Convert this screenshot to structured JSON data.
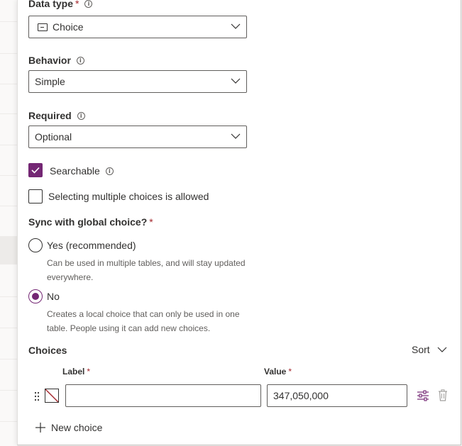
{
  "data_type": {
    "label": "Data type",
    "required_mark": "*",
    "value": "Choice",
    "icon": "choice-icon"
  },
  "behavior": {
    "label": "Behavior",
    "value": "Simple"
  },
  "required": {
    "label": "Required",
    "value": "Optional"
  },
  "searchable": {
    "label": "Searchable",
    "checked": true
  },
  "multi_select": {
    "label": "Selecting multiple choices is allowed",
    "checked": false
  },
  "sync_global": {
    "label": "Sync with global choice?",
    "required_mark": "*",
    "options": [
      {
        "label": "Yes (recommended)",
        "description": "Can be used in multiple tables, and will stay updated everywhere.",
        "selected": false
      },
      {
        "label": "No",
        "description": "Creates a local choice that can only be used in one table. People using it can add new choices.",
        "selected": true
      }
    ]
  },
  "choices": {
    "title": "Choices",
    "sort_label": "Sort",
    "label_header": "Label",
    "value_header": "Value",
    "required_mark": "*",
    "rows": [
      {
        "label": "",
        "value": "347,050,000"
      }
    ],
    "new_choice_label": "New choice"
  },
  "colors": {
    "accent": "#742774",
    "required": "#a4262c"
  }
}
